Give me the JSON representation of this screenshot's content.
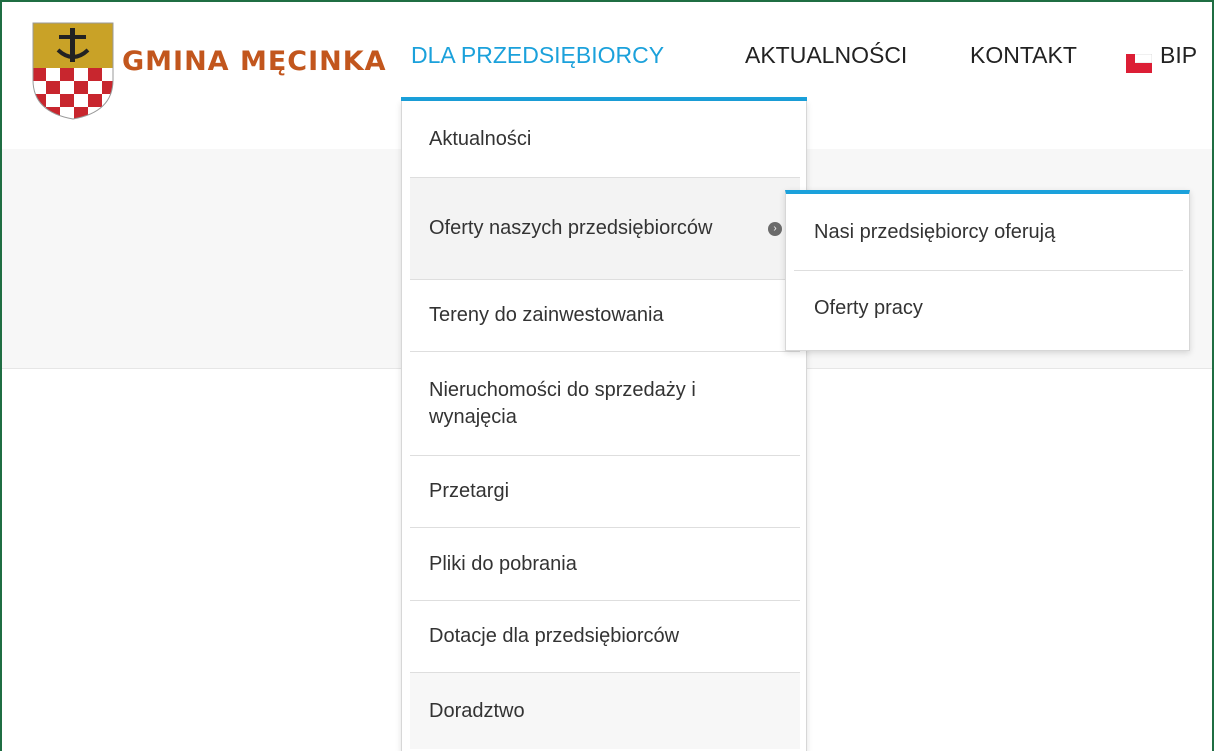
{
  "brand": {
    "name": "GMINA MĘCINKA",
    "logo_icon": "coat-of-arms-icon",
    "colors": {
      "brand_text": "#c2561d",
      "accent": "#1ba1db",
      "frame": "#1f6e43"
    }
  },
  "nav": {
    "items": [
      {
        "label": "DLA PRZEDSIĘBIORCY",
        "active": true
      },
      {
        "label": "AKTUALNOŚCI",
        "active": false
      },
      {
        "label": "KONTAKT",
        "active": false
      },
      {
        "label": "BIP",
        "active": false,
        "icon": "bip-flag-icon"
      }
    ]
  },
  "dropdown": {
    "items": [
      {
        "label": "Aktualności"
      },
      {
        "label": "Oferty naszych przedsiębiorców",
        "has_submenu": true,
        "icon": "chevron-right-icon"
      },
      {
        "label": "Tereny do zainwestowania"
      },
      {
        "label": "Nieruchomości do sprzedaży i wynajęcia"
      },
      {
        "label": "Przetargi"
      },
      {
        "label": "Pliki do pobrania"
      },
      {
        "label": "Dotacje dla przedsiębiorców"
      },
      {
        "label": "Doradztwo"
      }
    ]
  },
  "submenu": {
    "items": [
      {
        "label": "Nasi przedsiębiorcy oferują"
      },
      {
        "label": "Oferty pracy"
      }
    ]
  }
}
